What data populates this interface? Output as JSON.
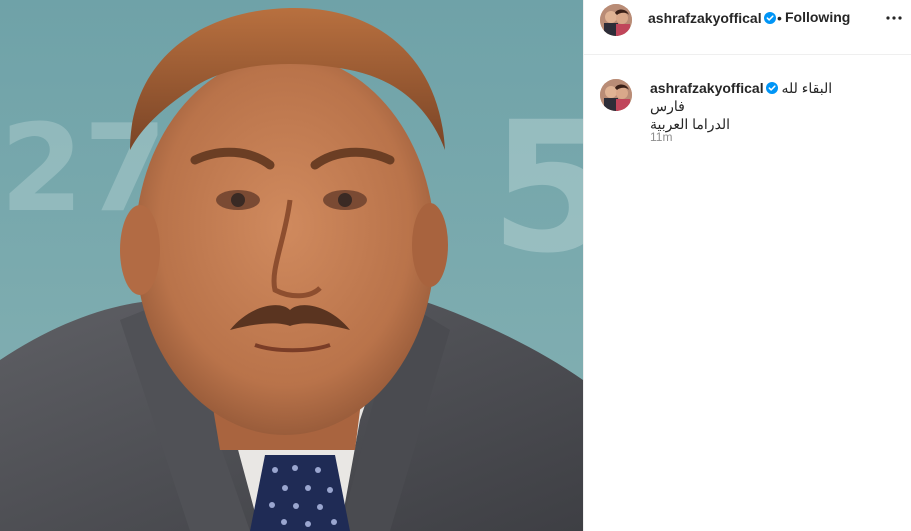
{
  "post": {
    "image_alt": "Portrait of an elderly man in a grey suit and blue polka-dot tie"
  },
  "header": {
    "username": "ashrafzakyoffical",
    "separator": "•",
    "follow_state": "Following",
    "more_icon": "more-horizontal-icon",
    "verified_icon": "verified-badge-icon"
  },
  "caption": {
    "username": "ashrafzakyoffical",
    "text_line1": "البقاء لله فارس",
    "text_line2": "الدراما العربية",
    "timestamp": "11m"
  },
  "colors": {
    "verified": "#0095f6",
    "text": "#262626",
    "secondary_text": "#8e8e8e",
    "divider": "#efefef"
  }
}
